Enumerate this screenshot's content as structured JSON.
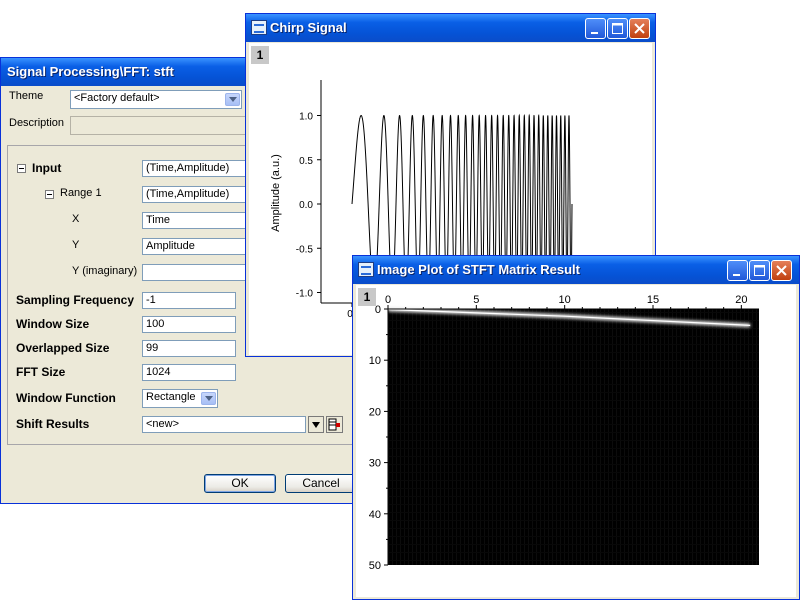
{
  "dialog": {
    "title": "Signal Processing\\FFT: stft",
    "theme_label": "Theme",
    "theme_value": "<Factory default>",
    "description_label": "Description",
    "description_value": "",
    "input_label": "Input",
    "input_value": "(Time,Amplitude)",
    "range1_label": "Range 1",
    "range1_value": "(Time,Amplitude)",
    "x_label": "X",
    "x_value": "Time",
    "y_label": "Y",
    "y_value": "Amplitude",
    "yimag_label": "Y (imaginary)",
    "yimag_value": "",
    "sampling_label": "Sampling Frequency",
    "sampling_value": "-1",
    "window_size_label": "Window Size",
    "window_size_value": "100",
    "overlap_label": "Overlapped Size",
    "overlap_value": "99",
    "fft_size_label": "FFT Size",
    "fft_size_value": "1024",
    "window_function_label": "Window Function",
    "window_function_value": "Rectangle",
    "shift_label": "Shift Results",
    "shift_value": "<new>",
    "ok_label": "OK",
    "cancel_label": "Cancel"
  },
  "chirp_window": {
    "title": "Chirp Signal",
    "layer_number": "1",
    "ylabel": "Amplitude (a.u.)",
    "y_ticks": [
      "1.0",
      "0.5",
      "0.0",
      "-0.5",
      "-1.0"
    ],
    "x_tick_first": "0"
  },
  "image_window": {
    "title": "Image Plot of STFT Matrix Result",
    "layer_number": "1",
    "x_ticks": [
      "0",
      "5",
      "10",
      "15",
      "20"
    ],
    "y_ticks": [
      "0",
      "10",
      "20",
      "30",
      "40",
      "50"
    ]
  },
  "colors": {
    "title_bar": "#0A5FE6",
    "window_face": "#ECE9D8",
    "image_background": "#000000"
  },
  "chart_data": [
    {
      "type": "line",
      "title": "Chirp Signal",
      "xlabel": "",
      "ylabel": "Amplitude (a.u.)",
      "ylim": [
        -1.2,
        1.2
      ],
      "xlim": [
        0,
        10
      ],
      "series": [
        {
          "function": "chirp",
          "amplitude": 1.0,
          "x_start": 0,
          "x_end": 10,
          "start_frequency": 0.5,
          "end_frequency": 5.5
        }
      ]
    },
    {
      "type": "heatmap",
      "title": "Image Plot of STFT Matrix Result",
      "xlim": [
        0,
        21
      ],
      "ylim": [
        0,
        50
      ],
      "x_ticks": [
        0,
        5,
        10,
        15,
        20
      ],
      "y_ticks": [
        0,
        10,
        20,
        30,
        40,
        50
      ],
      "ridge": {
        "x": [
          0,
          10,
          20.5
        ],
        "y": [
          0.1,
          1.4,
          3.2
        ]
      }
    }
  ]
}
